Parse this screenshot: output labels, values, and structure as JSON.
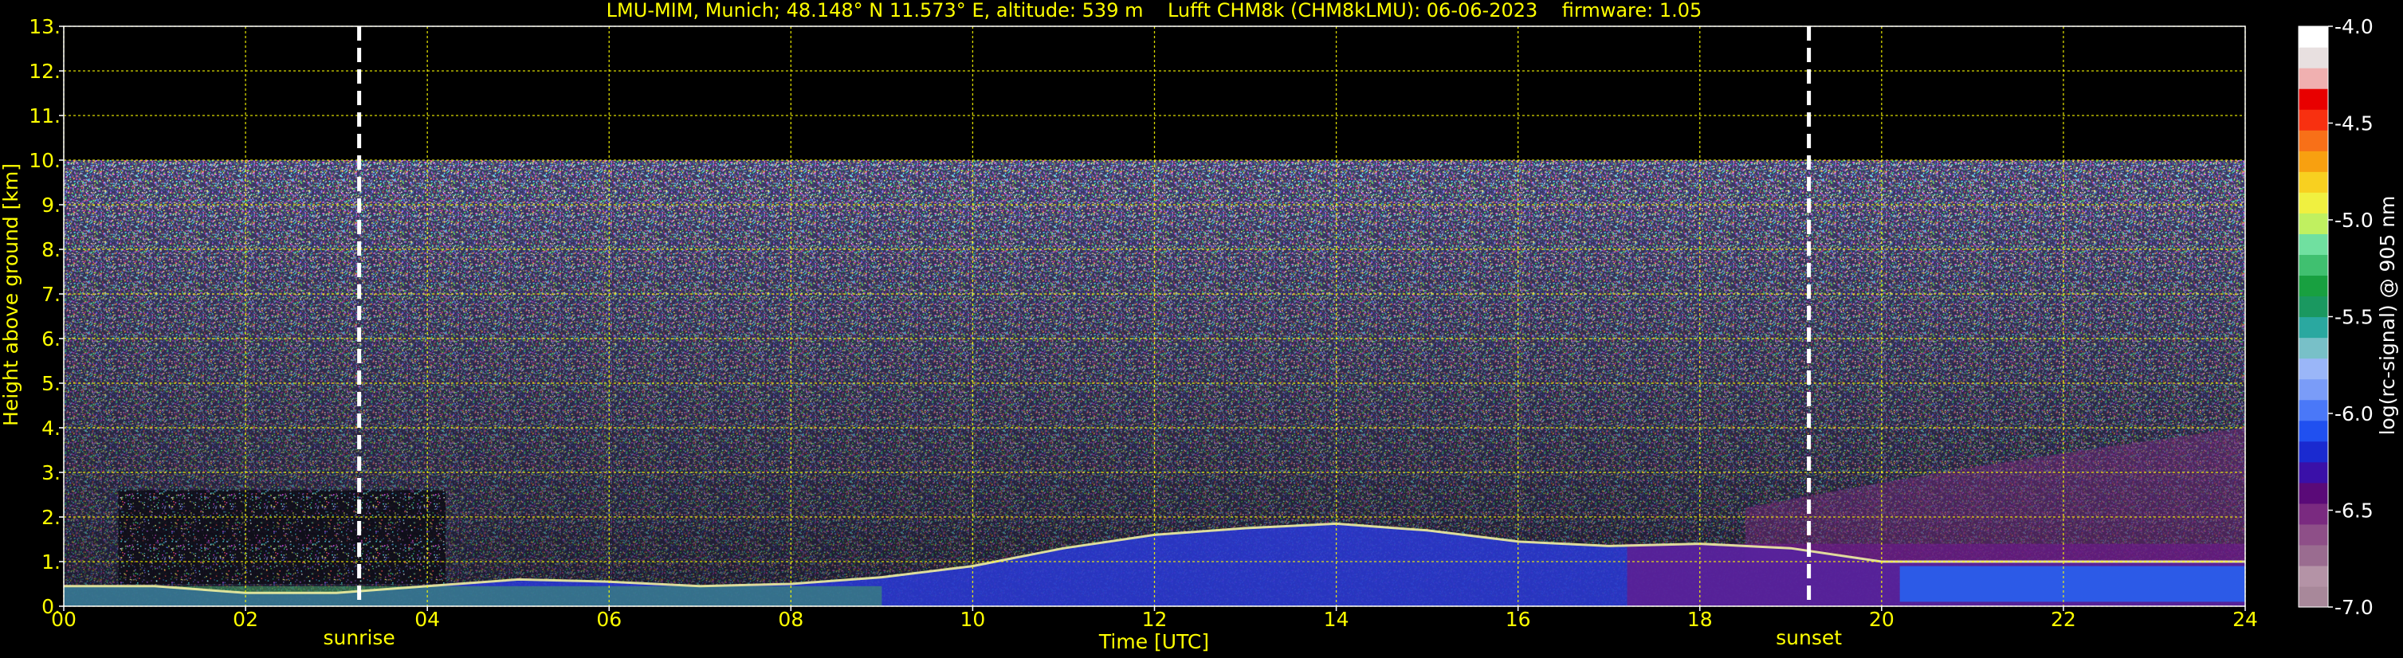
{
  "chart_data": {
    "type": "heatmap",
    "title": "LMU-MIM, Munich; 48.148° N 11.573° E, altitude: 539 m    Lufft CHM8k (CHM8kLMU): 06-06-2023    firmware: 1.05",
    "xlabel": "Time [UTC]",
    "ylabel": "Height above ground [km]",
    "xlim": [
      0,
      24
    ],
    "ylim": [
      0,
      13
    ],
    "x_ticks": [
      "00",
      "02",
      "04",
      "06",
      "08",
      "10",
      "12",
      "14",
      "16",
      "18",
      "20",
      "22",
      "24"
    ],
    "x_tick_values": [
      0,
      2,
      4,
      6,
      8,
      10,
      12,
      14,
      16,
      18,
      20,
      22,
      24
    ],
    "y_ticks": [
      "0.",
      "1.",
      "2.",
      "3.",
      "4.",
      "5.",
      "6.",
      "7.",
      "8.",
      "9.",
      "10.",
      "11.",
      "12.",
      "13."
    ],
    "y_tick_values": [
      0,
      1,
      2,
      3,
      4,
      5,
      6,
      7,
      8,
      9,
      10,
      11,
      12,
      13
    ],
    "grid": true,
    "grid_color": "#ffff00",
    "data_top_km": 10.0,
    "markers": [
      {
        "label": "sunrise",
        "time": 3.25
      },
      {
        "label": "sunset",
        "time": 19.2
      }
    ],
    "colorbar": {
      "label": "log(rc-signal) @ 905 nm",
      "range": [
        -7.0,
        -4.0
      ],
      "ticks": [
        "-4.0",
        "-4.5",
        "-5.0",
        "-5.5",
        "-6.0",
        "-6.5",
        "-7.0"
      ],
      "tick_values": [
        -4.0,
        -4.5,
        -5.0,
        -5.5,
        -6.0,
        -6.5,
        -7.0
      ],
      "colors": [
        "#a8889a",
        "#b493a6",
        "#9a6c90",
        "#8e4f88",
        "#7a2a80",
        "#5a0a78",
        "#3a10a8",
        "#1a2ad0",
        "#2050f0",
        "#4a78f8",
        "#7a9cf8",
        "#9ab6f8",
        "#78c0c8",
        "#2aa8a0",
        "#1a9860",
        "#18a040",
        "#40c070",
        "#70e0a0",
        "#c0f060",
        "#f0f040",
        "#f8d020",
        "#f8a010",
        "#f87018",
        "#f83010",
        "#e80000",
        "#f0b0b0",
        "#e8e0e0",
        "#ffffff"
      ]
    },
    "layers": [
      {
        "name": "boundary_layer_boundary",
        "x": [
          0,
          1,
          2,
          3,
          4,
          5,
          6,
          7,
          8,
          9,
          10,
          11,
          12,
          13,
          14,
          15,
          16,
          17,
          18,
          19,
          20,
          21,
          22,
          23,
          24
        ],
        "y": [
          0.45,
          0.45,
          0.3,
          0.3,
          0.45,
          0.6,
          0.55,
          0.45,
          0.5,
          0.65,
          0.9,
          1.3,
          1.6,
          1.75,
          1.85,
          1.7,
          1.45,
          1.35,
          1.4,
          1.3,
          1.0,
          1.0,
          1.0,
          1.0,
          1.0
        ]
      }
    ],
    "aerosol_top_km": [
      {
        "x": 18.5,
        "y": 2.2
      },
      {
        "x": 24,
        "y": 4.0
      }
    ]
  }
}
